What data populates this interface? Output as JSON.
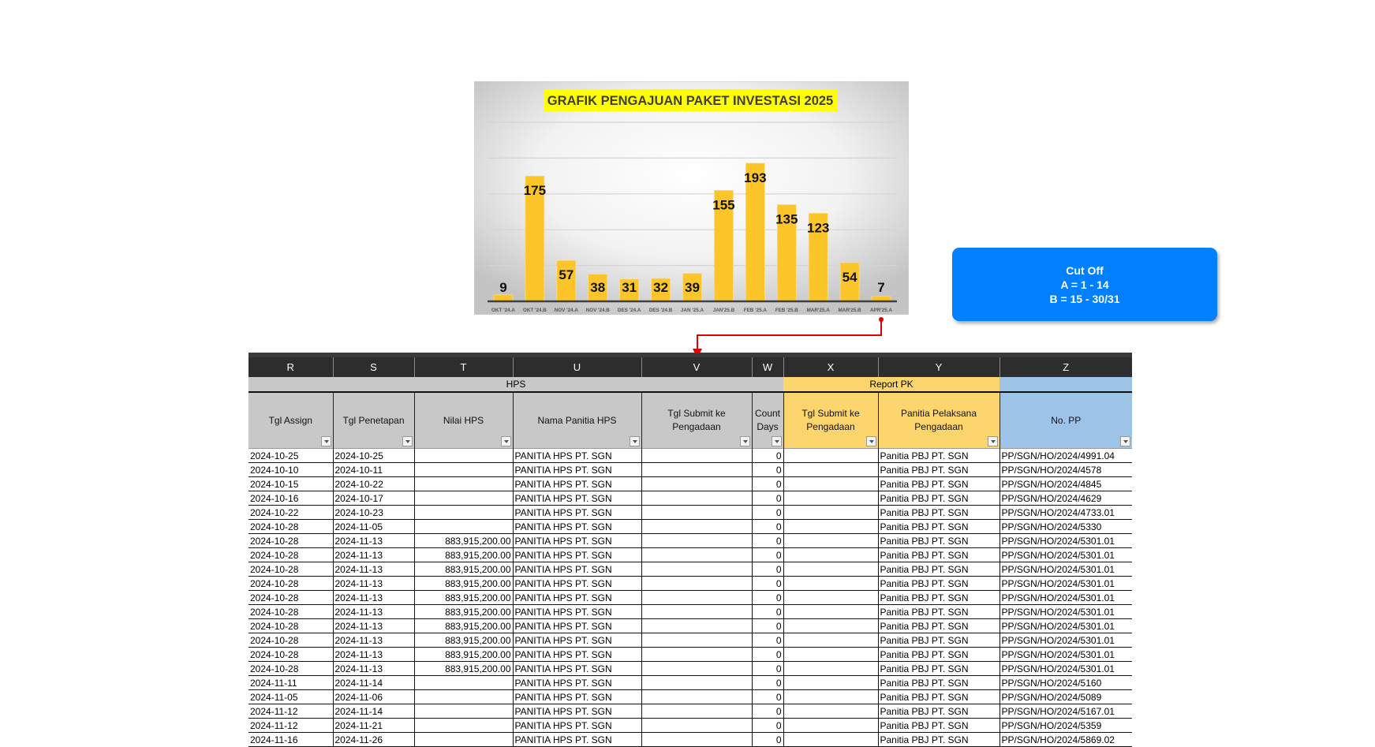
{
  "chart_data": {
    "type": "bar",
    "title": "GRAFIK PENGAJUAN PAKET INVESTASI 2025",
    "categories": [
      "OKT '24.A",
      "OKT '24.B",
      "NOV '24.A",
      "NOV '24.B",
      "DES '24.A",
      "DES '24.B",
      "JAN '25.A",
      "JAN'25.B",
      "FEB '25.A",
      "FEB '25.B",
      "MAR'25.A",
      "MAR'25.B",
      "APR'25.A"
    ],
    "values": [
      9,
      175,
      57,
      38,
      31,
      32,
      39,
      155,
      193,
      135,
      123,
      54,
      7
    ],
    "xlabel": "",
    "ylabel": "",
    "ylim": [
      0,
      250
    ],
    "gridlines": [
      50,
      100,
      150,
      200,
      250
    ],
    "grid": true,
    "legend": "none",
    "colors": {
      "bar": "#fcc62a",
      "title_bg": "#ffff00",
      "title_text": "#404040"
    }
  },
  "cutoff": {
    "line1": "Cut Off",
    "line2": "A = 1 - 14",
    "line3": "B = 15 - 30/31",
    "color": "#0080ff"
  },
  "sheet": {
    "column_letters": [
      "R",
      "S",
      "T",
      "U",
      "V",
      "W",
      "X",
      "Y",
      "Z"
    ],
    "groups": {
      "hps": "HPS",
      "report_pk": "Report PK",
      "pp": ""
    },
    "headers": [
      "Tgl Assign",
      "Tgl Penetapan",
      "Nilai HPS",
      "Nama Panitia HPS",
      "Tgl Submit ke Pengadaan",
      "Count Days",
      "Tgl Submit ke Pengadaan",
      "Panitia Pelaksana Pengadaan",
      "No. PP"
    ],
    "rows": [
      [
        "2024-10-25",
        "2024-10-25",
        "",
        "PANITIA HPS PT. SGN",
        "",
        "0",
        "",
        "Panitia PBJ PT. SGN",
        "PP/SGN/HO/2024/4991.04"
      ],
      [
        "2024-10-10",
        "2024-10-11",
        "",
        "PANITIA HPS PT. SGN",
        "",
        "0",
        "",
        "Panitia PBJ PT. SGN",
        "PP/SGN/HO/2024/4578"
      ],
      [
        "2024-10-15",
        "2024-10-22",
        "",
        "PANITIA HPS PT. SGN",
        "",
        "0",
        "",
        "Panitia PBJ PT. SGN",
        "PP/SGN/HO/2024/4845"
      ],
      [
        "2024-10-16",
        "2024-10-17",
        "",
        "PANITIA HPS PT. SGN",
        "",
        "0",
        "",
        "Panitia PBJ PT. SGN",
        "PP/SGN/HO/2024/4629"
      ],
      [
        "2024-10-22",
        "2024-10-23",
        "",
        "PANITIA HPS PT. SGN",
        "",
        "0",
        "",
        "Panitia PBJ PT. SGN",
        "PP/SGN/HO/2024/4733.01"
      ],
      [
        "2024-10-28",
        "2024-11-05",
        "",
        "PANITIA HPS PT. SGN",
        "",
        "0",
        "",
        "Panitia PBJ PT. SGN",
        "PP/SGN/HO/2024/5330"
      ],
      [
        "2024-10-28",
        "2024-11-13",
        "883,915,200.00",
        "PANITIA HPS PT. SGN",
        "",
        "0",
        "",
        "Panitia PBJ PT. SGN",
        "PP/SGN/HO/2024/5301.01"
      ],
      [
        "2024-10-28",
        "2024-11-13",
        "883,915,200.00",
        "PANITIA HPS PT. SGN",
        "",
        "0",
        "",
        "Panitia PBJ PT. SGN",
        "PP/SGN/HO/2024/5301.01"
      ],
      [
        "2024-10-28",
        "2024-11-13",
        "883,915,200.00",
        "PANITIA HPS PT. SGN",
        "",
        "0",
        "",
        "Panitia PBJ PT. SGN",
        "PP/SGN/HO/2024/5301.01"
      ],
      [
        "2024-10-28",
        "2024-11-13",
        "883,915,200.00",
        "PANITIA HPS PT. SGN",
        "",
        "0",
        "",
        "Panitia PBJ PT. SGN",
        "PP/SGN/HO/2024/5301.01"
      ],
      [
        "2024-10-28",
        "2024-11-13",
        "883,915,200.00",
        "PANITIA HPS PT. SGN",
        "",
        "0",
        "",
        "Panitia PBJ PT. SGN",
        "PP/SGN/HO/2024/5301.01"
      ],
      [
        "2024-10-28",
        "2024-11-13",
        "883,915,200.00",
        "PANITIA HPS PT. SGN",
        "",
        "0",
        "",
        "Panitia PBJ PT. SGN",
        "PP/SGN/HO/2024/5301.01"
      ],
      [
        "2024-10-28",
        "2024-11-13",
        "883,915,200.00",
        "PANITIA HPS PT. SGN",
        "",
        "0",
        "",
        "Panitia PBJ PT. SGN",
        "PP/SGN/HO/2024/5301.01"
      ],
      [
        "2024-10-28",
        "2024-11-13",
        "883,915,200.00",
        "PANITIA HPS PT. SGN",
        "",
        "0",
        "",
        "Panitia PBJ PT. SGN",
        "PP/SGN/HO/2024/5301.01"
      ],
      [
        "2024-10-28",
        "2024-11-13",
        "883,915,200.00",
        "PANITIA HPS PT. SGN",
        "",
        "0",
        "",
        "Panitia PBJ PT. SGN",
        "PP/SGN/HO/2024/5301.01"
      ],
      [
        "2024-10-28",
        "2024-11-13",
        "883,915,200.00",
        "PANITIA HPS PT. SGN",
        "",
        "0",
        "",
        "Panitia PBJ PT. SGN",
        "PP/SGN/HO/2024/5301.01"
      ],
      [
        "2024-11-11",
        "2024-11-14",
        "",
        "PANITIA HPS PT. SGN",
        "",
        "0",
        "",
        "Panitia PBJ PT. SGN",
        "PP/SGN/HO/2024/5160"
      ],
      [
        "2024-11-05",
        "2024-11-06",
        "",
        "PANITIA HPS PT. SGN",
        "",
        "0",
        "",
        "Panitia PBJ PT. SGN",
        "PP/SGN/HO/2024/5089"
      ],
      [
        "2024-11-12",
        "2024-11-14",
        "",
        "PANITIA HPS PT. SGN",
        "",
        "0",
        "",
        "Panitia PBJ PT. SGN",
        "PP/SGN/HO/2024/5167.01"
      ],
      [
        "2024-11-12",
        "2024-11-21",
        "",
        "PANITIA HPS PT. SGN",
        "",
        "0",
        "",
        "Panitia PBJ PT. SGN",
        "PP/SGN/HO/2024/5359"
      ],
      [
        "2024-11-16",
        "2024-11-26",
        "",
        "PANITIA HPS PT. SGN",
        "",
        "0",
        "",
        "Panitia PBJ PT. SGN",
        "PP/SGN/HO/2024/5869.02"
      ]
    ]
  }
}
